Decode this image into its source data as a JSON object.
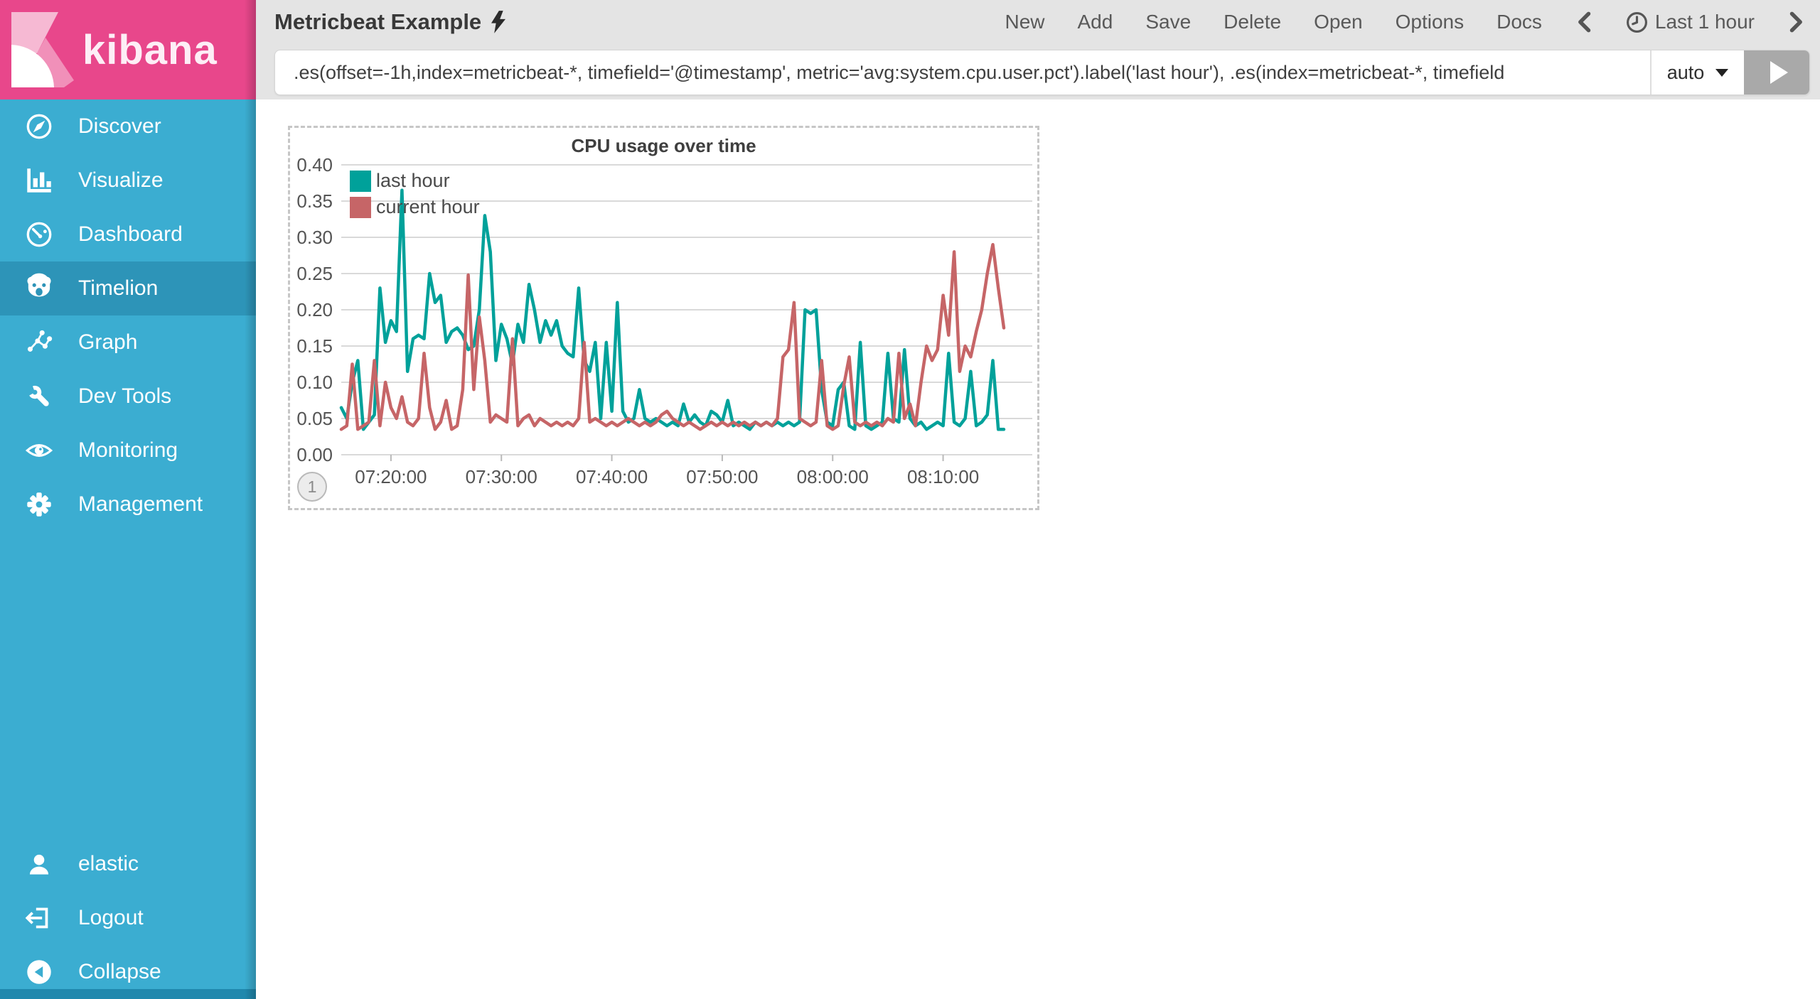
{
  "brand": {
    "name": "kibana",
    "color": "#e8478b"
  },
  "sidebar": {
    "colors": {
      "bg": "#3badd1",
      "active_bg": "#2d94b8"
    },
    "items": [
      {
        "label": "Discover",
        "icon": "compass-icon",
        "active": false
      },
      {
        "label": "Visualize",
        "icon": "bar-chart-icon",
        "active": false
      },
      {
        "label": "Dashboard",
        "icon": "dashboard-icon",
        "active": false
      },
      {
        "label": "Timelion",
        "icon": "timelion-bear-icon",
        "active": true
      },
      {
        "label": "Graph",
        "icon": "graph-icon",
        "active": false
      },
      {
        "label": "Dev Tools",
        "icon": "wrench-icon",
        "active": false
      },
      {
        "label": "Monitoring",
        "icon": "eye-icon",
        "active": false
      },
      {
        "label": "Management",
        "icon": "gear-icon",
        "active": false
      }
    ],
    "footer": [
      {
        "label": "elastic",
        "icon": "user-icon"
      },
      {
        "label": "Logout",
        "icon": "logout-icon"
      },
      {
        "label": "Collapse",
        "icon": "collapse-icon"
      }
    ]
  },
  "toolbar": {
    "sheet_title": "Metricbeat Example",
    "title_icon": "lightning-icon",
    "menu": [
      "New",
      "Add",
      "Save",
      "Delete",
      "Open",
      "Options",
      "Docs"
    ],
    "time_picker": {
      "back": "previous",
      "clock_icon": "clock-icon",
      "label": "Last 1 hour",
      "forward": "next"
    }
  },
  "query": {
    "value": ".es(offset=-1h,index=metricbeat-*, timefield='@timestamp', metric='avg:system.cpu.user.pct').label('last hour'), .es(index=metricbeat-*, timefield",
    "interval": "auto"
  },
  "panel": {
    "index_badge": "1"
  },
  "chart_data": {
    "type": "line",
    "title": "CPU usage over time",
    "xlabel": "",
    "ylabel": "",
    "ylim": [
      0,
      0.4
    ],
    "grid": true,
    "legend_position": "top-left",
    "x_start": "07:15:30",
    "x_end": "08:15:30",
    "x_interval_seconds": 30,
    "y_ticks": [
      "0.00",
      "0.05",
      "0.10",
      "0.15",
      "0.20",
      "0.25",
      "0.30",
      "0.35",
      "0.40"
    ],
    "x_ticks": [
      {
        "index": 9,
        "label": "07:20:00"
      },
      {
        "index": 29,
        "label": "07:30:00"
      },
      {
        "index": 49,
        "label": "07:40:00"
      },
      {
        "index": 69,
        "label": "07:50:00"
      },
      {
        "index": 89,
        "label": "08:00:00"
      },
      {
        "index": 109,
        "label": "08:10:00"
      }
    ],
    "series": [
      {
        "name": "last hour",
        "color": "#00a19a",
        "values": [
          0.065,
          0.05,
          0.1,
          0.13,
          0.035,
          0.045,
          0.055,
          0.23,
          0.155,
          0.185,
          0.17,
          0.365,
          0.115,
          0.16,
          0.165,
          0.16,
          0.25,
          0.21,
          0.22,
          0.155,
          0.17,
          0.175,
          0.165,
          0.145,
          0.15,
          0.2,
          0.33,
          0.28,
          0.13,
          0.18,
          0.16,
          0.125,
          0.18,
          0.155,
          0.235,
          0.2,
          0.155,
          0.185,
          0.165,
          0.185,
          0.15,
          0.14,
          0.135,
          0.23,
          0.13,
          0.115,
          0.155,
          0.05,
          0.155,
          0.06,
          0.21,
          0.06,
          0.045,
          0.05,
          0.09,
          0.05,
          0.045,
          0.05,
          0.045,
          0.04,
          0.045,
          0.04,
          0.07,
          0.045,
          0.055,
          0.045,
          0.04,
          0.06,
          0.055,
          0.045,
          0.075,
          0.04,
          0.045,
          0.04,
          0.035,
          0.045,
          0.04,
          0.045,
          0.04,
          0.045,
          0.04,
          0.045,
          0.04,
          0.045,
          0.2,
          0.195,
          0.2,
          0.09,
          0.045,
          0.04,
          0.09,
          0.1,
          0.04,
          0.035,
          0.155,
          0.04,
          0.035,
          0.04,
          0.045,
          0.14,
          0.05,
          0.045,
          0.145,
          0.05,
          0.04,
          0.045,
          0.035,
          0.04,
          0.045,
          0.04,
          0.14,
          0.045,
          0.04,
          0.05,
          0.115,
          0.04,
          0.045,
          0.055,
          0.13,
          0.035,
          0.035
        ]
      },
      {
        "name": "current hour",
        "color": "#c66567",
        "values": [
          0.035,
          0.04,
          0.125,
          0.035,
          0.04,
          0.045,
          0.13,
          0.04,
          0.1,
          0.065,
          0.05,
          0.08,
          0.045,
          0.04,
          0.05,
          0.14,
          0.065,
          0.035,
          0.045,
          0.075,
          0.035,
          0.04,
          0.09,
          0.248,
          0.09,
          0.19,
          0.13,
          0.045,
          0.055,
          0.05,
          0.045,
          0.16,
          0.04,
          0.05,
          0.055,
          0.04,
          0.05,
          0.045,
          0.04,
          0.045,
          0.04,
          0.045,
          0.04,
          0.05,
          0.155,
          0.045,
          0.05,
          0.045,
          0.04,
          0.045,
          0.04,
          0.045,
          0.05,
          0.045,
          0.04,
          0.045,
          0.04,
          0.045,
          0.055,
          0.06,
          0.05,
          0.045,
          0.04,
          0.045,
          0.04,
          0.035,
          0.04,
          0.045,
          0.04,
          0.045,
          0.04,
          0.045,
          0.04,
          0.045,
          0.04,
          0.045,
          0.04,
          0.045,
          0.04,
          0.05,
          0.135,
          0.145,
          0.21,
          0.05,
          0.045,
          0.04,
          0.045,
          0.13,
          0.04,
          0.035,
          0.04,
          0.095,
          0.135,
          0.045,
          0.04,
          0.045,
          0.04,
          0.045,
          0.04,
          0.05,
          0.045,
          0.14,
          0.05,
          0.07,
          0.04,
          0.1,
          0.15,
          0.13,
          0.145,
          0.22,
          0.165,
          0.28,
          0.115,
          0.15,
          0.135,
          0.17,
          0.2,
          0.25,
          0.29,
          0.23,
          0.175
        ]
      }
    ]
  }
}
